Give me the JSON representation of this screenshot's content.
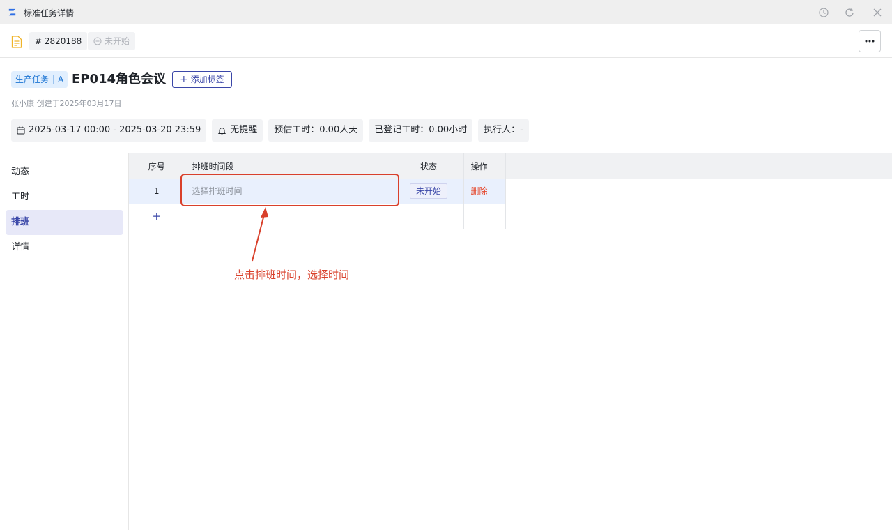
{
  "window": {
    "title": "标准任务详情"
  },
  "toolbar": {
    "id_label": "# 2820188",
    "status_label": "未开始"
  },
  "header": {
    "type_tag": "生产任务",
    "type_tag_suffix": "A",
    "title": "EP014角色会议",
    "add_tag_label": "添加标签",
    "meta": "张小康 创建于2025年03月17日",
    "date_range": "2025-03-17 00:00 - 2025-03-20 23:59",
    "reminder": "无提醒",
    "estimated_hours": "预估工时：0.00人天",
    "logged_hours": "已登记工时：0.00小时",
    "assignee": "执行人：-"
  },
  "sidebar": {
    "items": [
      {
        "label": "动态"
      },
      {
        "label": "工时"
      },
      {
        "label": "排班"
      },
      {
        "label": "详情"
      }
    ],
    "active": "排班"
  },
  "table": {
    "columns": [
      "序号",
      "排班时间段",
      "状态",
      "操作"
    ],
    "rows": [
      {
        "index": "1",
        "time_placeholder": "选择排班时间",
        "status": "未开始",
        "action": "删除"
      }
    ],
    "add_row": "+"
  },
  "annotation": {
    "text": "点击排班时间，选择时间"
  },
  "colors": {
    "accent": "#3b47a8",
    "danger": "#e5462b",
    "annotation": "#d9402b",
    "tag_bg": "#e1effe"
  },
  "icons": {
    "app": "app-logo-icon",
    "history": "history-icon",
    "refresh": "refresh-icon",
    "close": "close-icon",
    "doc": "document-icon",
    "more": "more-dots-icon",
    "calendar": "calendar-icon",
    "bell": "bell-icon"
  }
}
